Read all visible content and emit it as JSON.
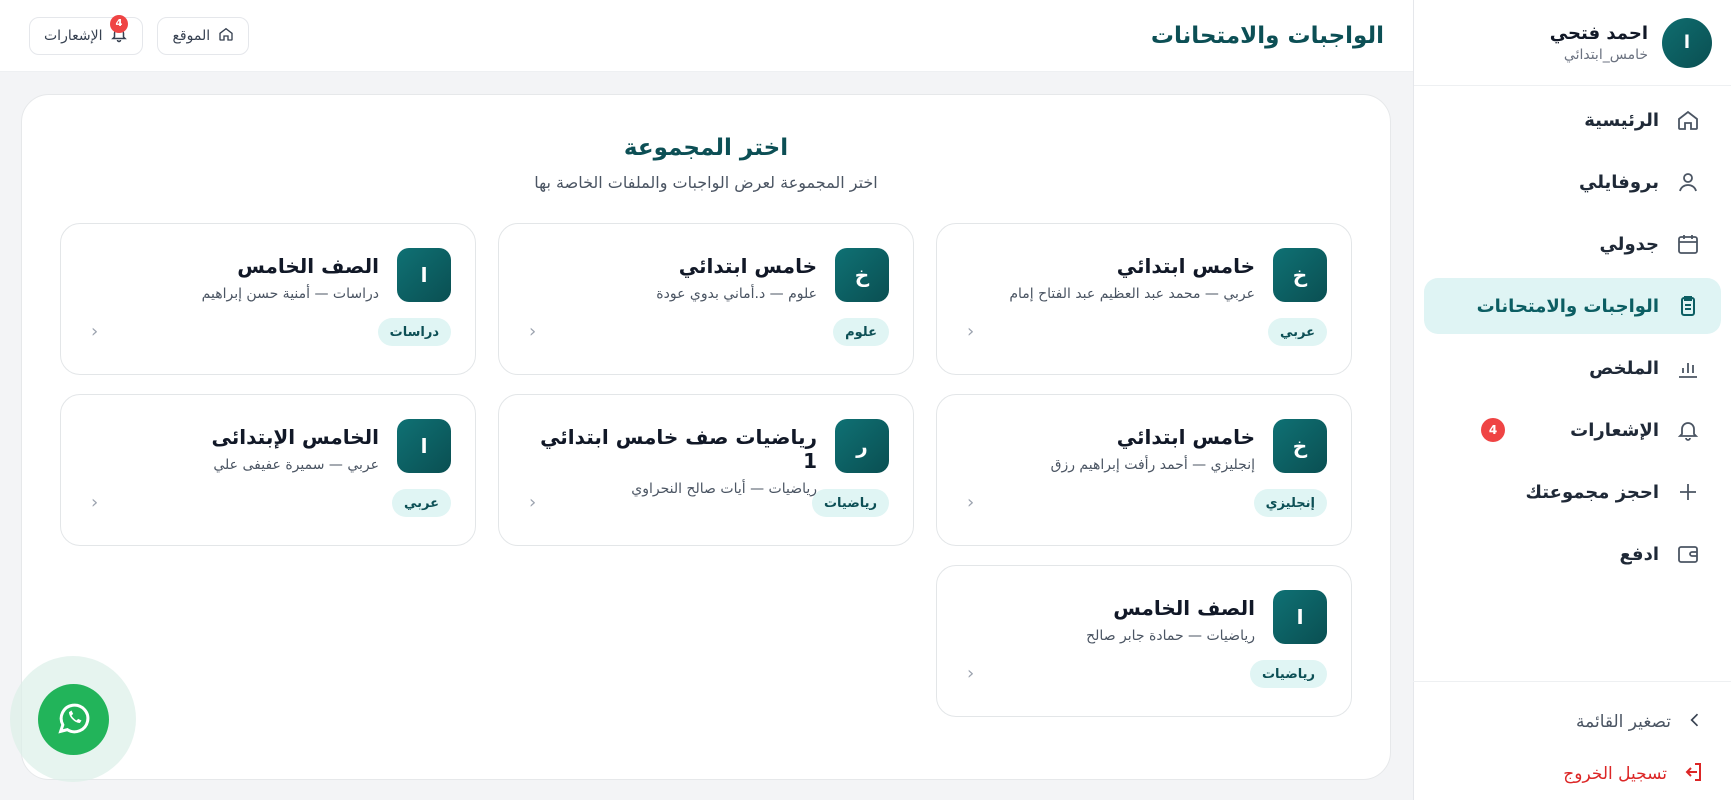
{
  "user": {
    "initial": "ا",
    "name": "احمد فتحي",
    "grade": "خامس_ابتدائي"
  },
  "sidebar": {
    "items": [
      {
        "label": "الرئيسية",
        "icon": "home-icon"
      },
      {
        "label": "بروفايلي",
        "icon": "user-icon"
      },
      {
        "label": "جدولي",
        "icon": "calendar-icon"
      },
      {
        "label": "الواجبات والامتحانات",
        "icon": "clipboard-icon",
        "active": true
      },
      {
        "label": "الملخص",
        "icon": "bar-chart-icon"
      },
      {
        "label": "الإشعارات",
        "icon": "bell-icon",
        "badge": "4"
      },
      {
        "label": "احجز مجموعتك",
        "icon": "plus-icon"
      },
      {
        "label": "ادفع",
        "icon": "wallet-icon"
      }
    ],
    "collapse_label": "تصغير القائمة",
    "logout_label": "تسجيل الخروج"
  },
  "header": {
    "title": "الواجبات والامتحانات",
    "site_label": "الموقع",
    "notifications_label": "الإشعارات",
    "notifications_count": "4"
  },
  "main": {
    "title": "اختر المجموعة",
    "subtitle": "اختر المجموعة لعرض الواجبات والملفات الخاصة بها",
    "groups": [
      {
        "initial": "خ",
        "title": "خامس ابتدائي",
        "subtitle": "عربي — محمد عبد العظيم عبد الفتاح إمام",
        "tag": "عربي"
      },
      {
        "initial": "خ",
        "title": "خامس ابتدائي",
        "subtitle": "علوم — د.أماني بدوي عودة",
        "tag": "علوم"
      },
      {
        "initial": "ا",
        "title": "الصف الخامس",
        "subtitle": "دراسات — أمنية حسن إبراهيم",
        "tag": "دراسات"
      },
      {
        "initial": "خ",
        "title": "خامس ابتدائي",
        "subtitle": "إنجليزي — أحمد رأفت إبراهيم رزق",
        "tag": "إنجليزي"
      },
      {
        "initial": "ر",
        "title": "رياضيات صف خامس ابتدائي 1",
        "subtitle": "رياضيات — أيات صالح النحراوي",
        "tag": "رياضيات"
      },
      {
        "initial": "ا",
        "title": "الخامس الإبتدائى",
        "subtitle": "عربي — سميرة عفيفى علي",
        "tag": "عربي"
      },
      {
        "initial": "ا",
        "title": "الصف الخامس",
        "subtitle": "رياضيات — حمادة جابر صالح",
        "tag": "رياضيات"
      }
    ]
  },
  "colors": {
    "accent": "#0c5e63",
    "active_bg": "#dff4f4",
    "badge": "#ef4444",
    "whatsapp": "#22b45a"
  }
}
